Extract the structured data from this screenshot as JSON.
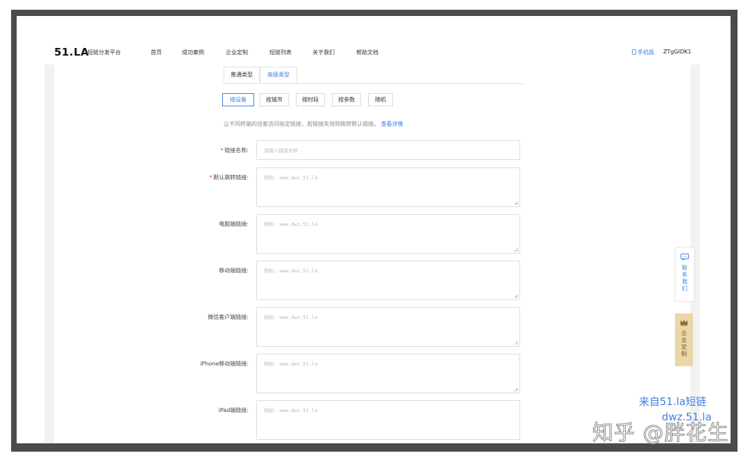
{
  "header": {
    "logo": "51.LA",
    "logo_sub": "短链分发平台",
    "nav": [
      "首页",
      "成功案例",
      "企业定制",
      "短链列表",
      "关于我们",
      "帮助文档"
    ],
    "mobile_version": "手机版",
    "username": "ZTgGIDK1"
  },
  "tabs": [
    "普通类型",
    "高级类型"
  ],
  "active_tab": "高级类型",
  "segments": [
    "按设备",
    "按城市",
    "按时段",
    "按参数",
    "随机"
  ],
  "active_segment": "按设备",
  "hint": {
    "text": "让不同终端的访客访问指定链接，若链接失效则跳转默认链接。",
    "link": "查看详情"
  },
  "form": {
    "name": {
      "label": "链接名称:",
      "placeholder": "请输入链接名称",
      "required": true
    },
    "default": {
      "label": "默认跳转链接:",
      "placeholder": "例如: www.dwz.51.la",
      "required": true
    },
    "pc": {
      "label": "电脑端链接:",
      "placeholder": "例如: www.dwz.51.la"
    },
    "mobile": {
      "label": "移动端链接:",
      "placeholder": "例如: www.dwz.51.la"
    },
    "wechat": {
      "label": "微信客户端链接:",
      "placeholder": "例如: www.dwz.51.la"
    },
    "iphone": {
      "label": "iPhone移动端链接:",
      "placeholder": "例如: www.dwz.51.la"
    },
    "ipad": {
      "label": "iPad端链接:",
      "placeholder": "例如: www.dwz.51.la"
    }
  },
  "required_mark": "*",
  "side": {
    "contact": "联系我们",
    "enterprise": "企业定制"
  },
  "watermark": {
    "line1": "来自51.la短链",
    "line2": "dwz.51.la",
    "zhihu": "知乎 @胖花生"
  },
  "colors": {
    "accent": "#3d7fe0",
    "frame": "#4b4b4b",
    "required": "#e53935",
    "enterprise_bg": "#ead7a8"
  },
  "icons": {
    "mobile": "phone-icon",
    "contact": "chat-bubble-icon",
    "enterprise": "crown-icon"
  }
}
